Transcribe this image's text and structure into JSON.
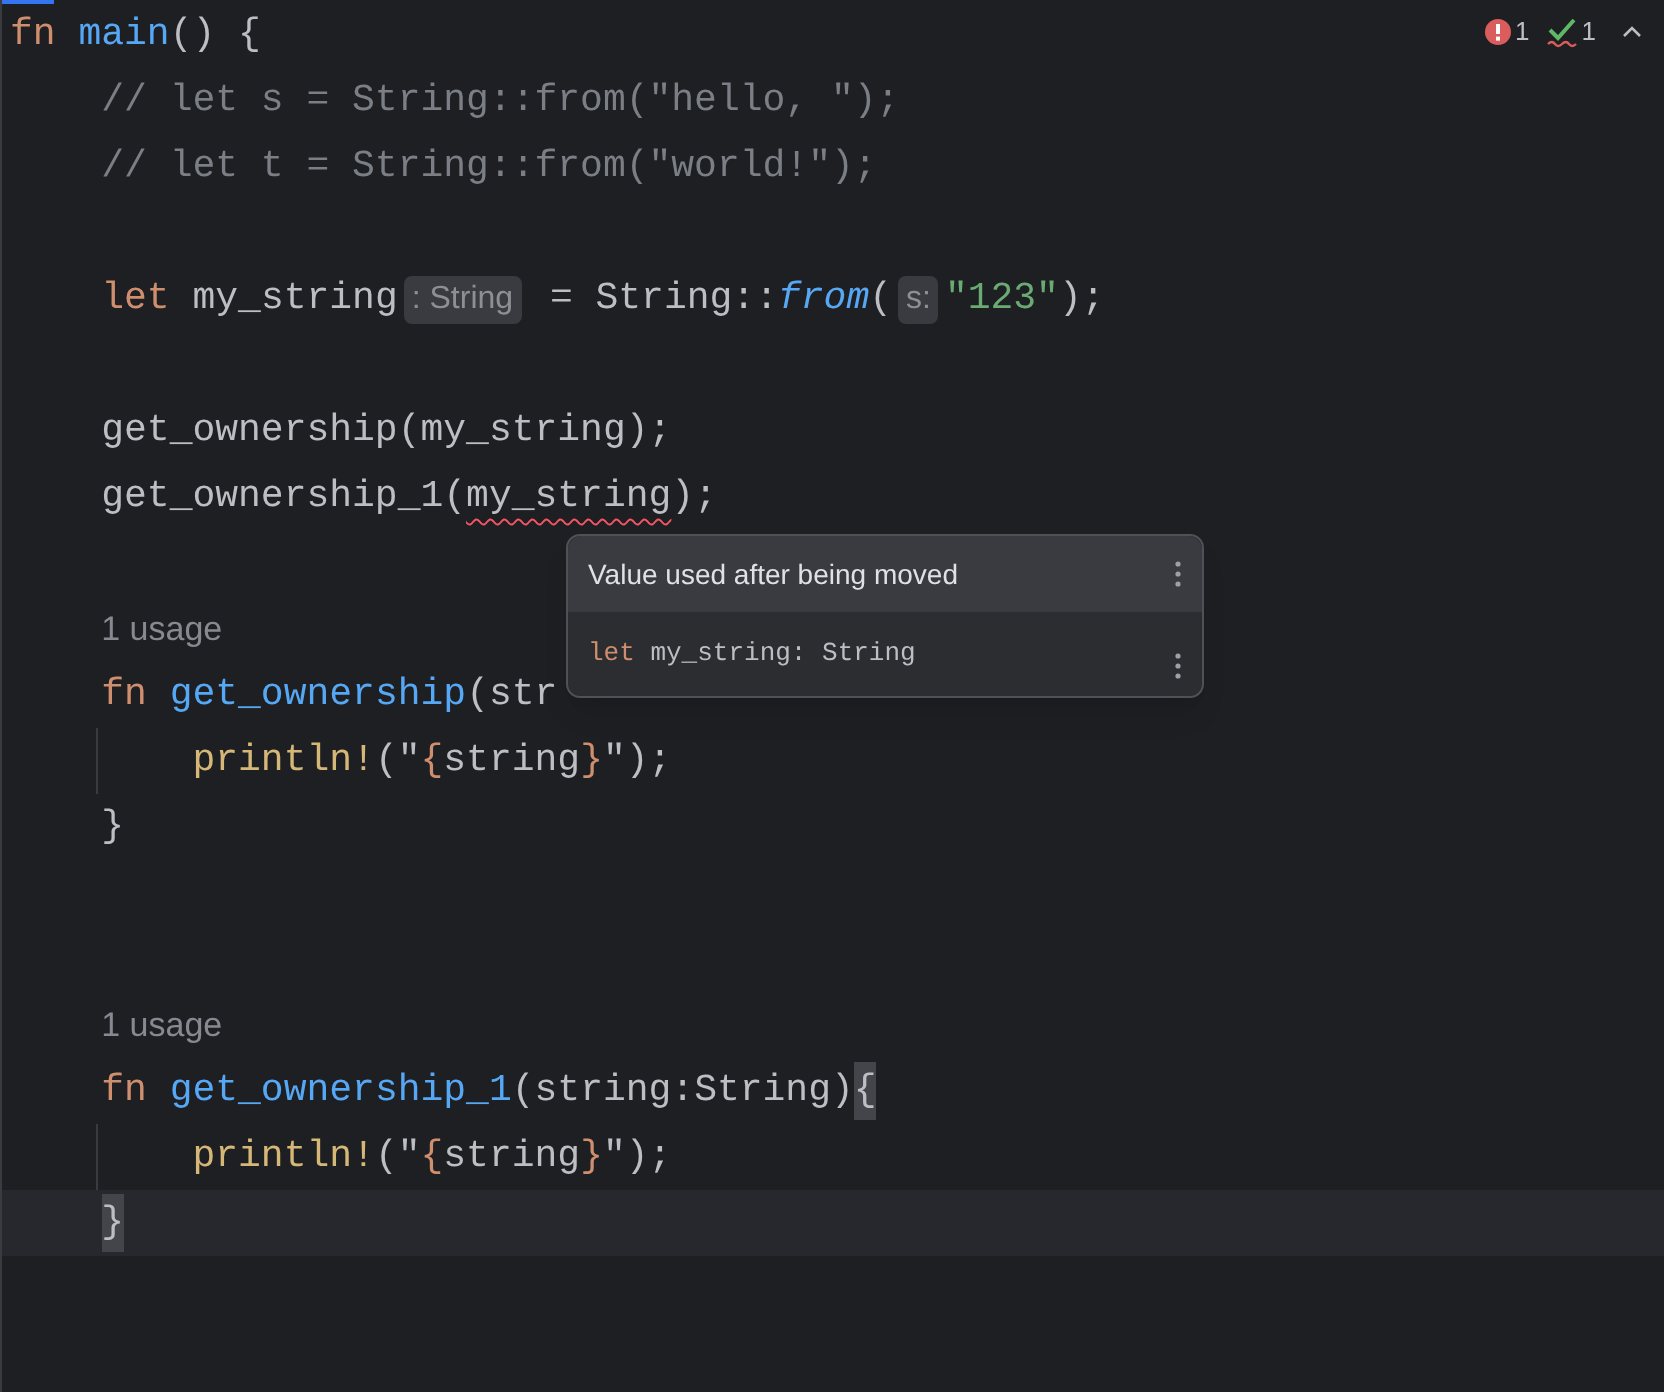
{
  "status": {
    "errors": "1",
    "warnings": "1"
  },
  "lines": [
    {
      "tokens": [
        {
          "kind": "keyword",
          "text": "fn"
        },
        {
          "kind": "function",
          "text": " main"
        },
        {
          "kind": "plain",
          "text": "() {"
        }
      ]
    },
    {
      "tokens": [
        {
          "kind": "comment",
          "text": "    // let s = String::from(\"hello, \");"
        }
      ]
    },
    {
      "tokens": [
        {
          "kind": "comment",
          "text": "    // let t = String::from(\"world!\");"
        }
      ]
    },
    {
      "kind": "blank"
    },
    {
      "tokens": [
        {
          "kind": "keyword",
          "text": "    let"
        },
        {
          "kind": "plain",
          "text": " my_string"
        },
        {
          "kind": "hint",
          "text": ": String"
        },
        {
          "kind": "plain",
          "text": " = String::"
        },
        {
          "kind": "call",
          "text": "from"
        },
        {
          "kind": "plain",
          "text": "("
        },
        {
          "kind": "hint",
          "text": "s:"
        },
        {
          "kind": "string",
          "text": "\"123\""
        },
        {
          "kind": "plain",
          "text": ");"
        }
      ]
    },
    {
      "kind": "blank"
    },
    {
      "tokens": [
        {
          "kind": "plain",
          "text": "    get_ownership(my_string);"
        }
      ]
    },
    {
      "tokens": [
        {
          "kind": "plain",
          "text": "    get_ownership_1("
        },
        {
          "kind": "error",
          "text": "my_string"
        },
        {
          "kind": "plain",
          "text": ");"
        }
      ]
    },
    {
      "kind": "blank"
    },
    {
      "tokens": [
        {
          "kind": "usage",
          "text": "    1 usage"
        }
      ]
    },
    {
      "tokens": [
        {
          "kind": "keyword",
          "text": "    fn"
        },
        {
          "kind": "function",
          "text": " get_ownership"
        },
        {
          "kind": "plain",
          "text": "(str"
        }
      ]
    },
    {
      "guide": true,
      "tokens": [
        {
          "kind": "macro",
          "text": "        println!"
        },
        {
          "kind": "plain",
          "text": "(\""
        },
        {
          "kind": "brace",
          "text": "{"
        },
        {
          "kind": "plain",
          "text": "string"
        },
        {
          "kind": "brace",
          "text": "}"
        },
        {
          "kind": "plain",
          "text": "\");"
        }
      ]
    },
    {
      "tokens": [
        {
          "kind": "plain",
          "text": "    }"
        }
      ]
    },
    {
      "kind": "blank"
    },
    {
      "kind": "blank"
    },
    {
      "tokens": [
        {
          "kind": "usage",
          "text": "    1 usage"
        }
      ]
    },
    {
      "tokens": [
        {
          "kind": "keyword",
          "text": "    fn"
        },
        {
          "kind": "function",
          "text": " get_ownership_1"
        },
        {
          "kind": "plain",
          "text": "(string:String)"
        },
        {
          "kind": "match",
          "text": "{"
        }
      ]
    },
    {
      "guide": true,
      "tokens": [
        {
          "kind": "macro",
          "text": "        println!"
        },
        {
          "kind": "plain",
          "text": "(\""
        },
        {
          "kind": "brace",
          "text": "{"
        },
        {
          "kind": "plain",
          "text": "string"
        },
        {
          "kind": "brace",
          "text": "}"
        },
        {
          "kind": "plain",
          "text": "\");"
        }
      ]
    },
    {
      "current": true,
      "tokens": [
        {
          "kind": "match",
          "text": "    }"
        }
      ]
    }
  ],
  "popup": {
    "title": "Value used after being moved",
    "keyword": "let",
    "detail": " my_string: String"
  }
}
